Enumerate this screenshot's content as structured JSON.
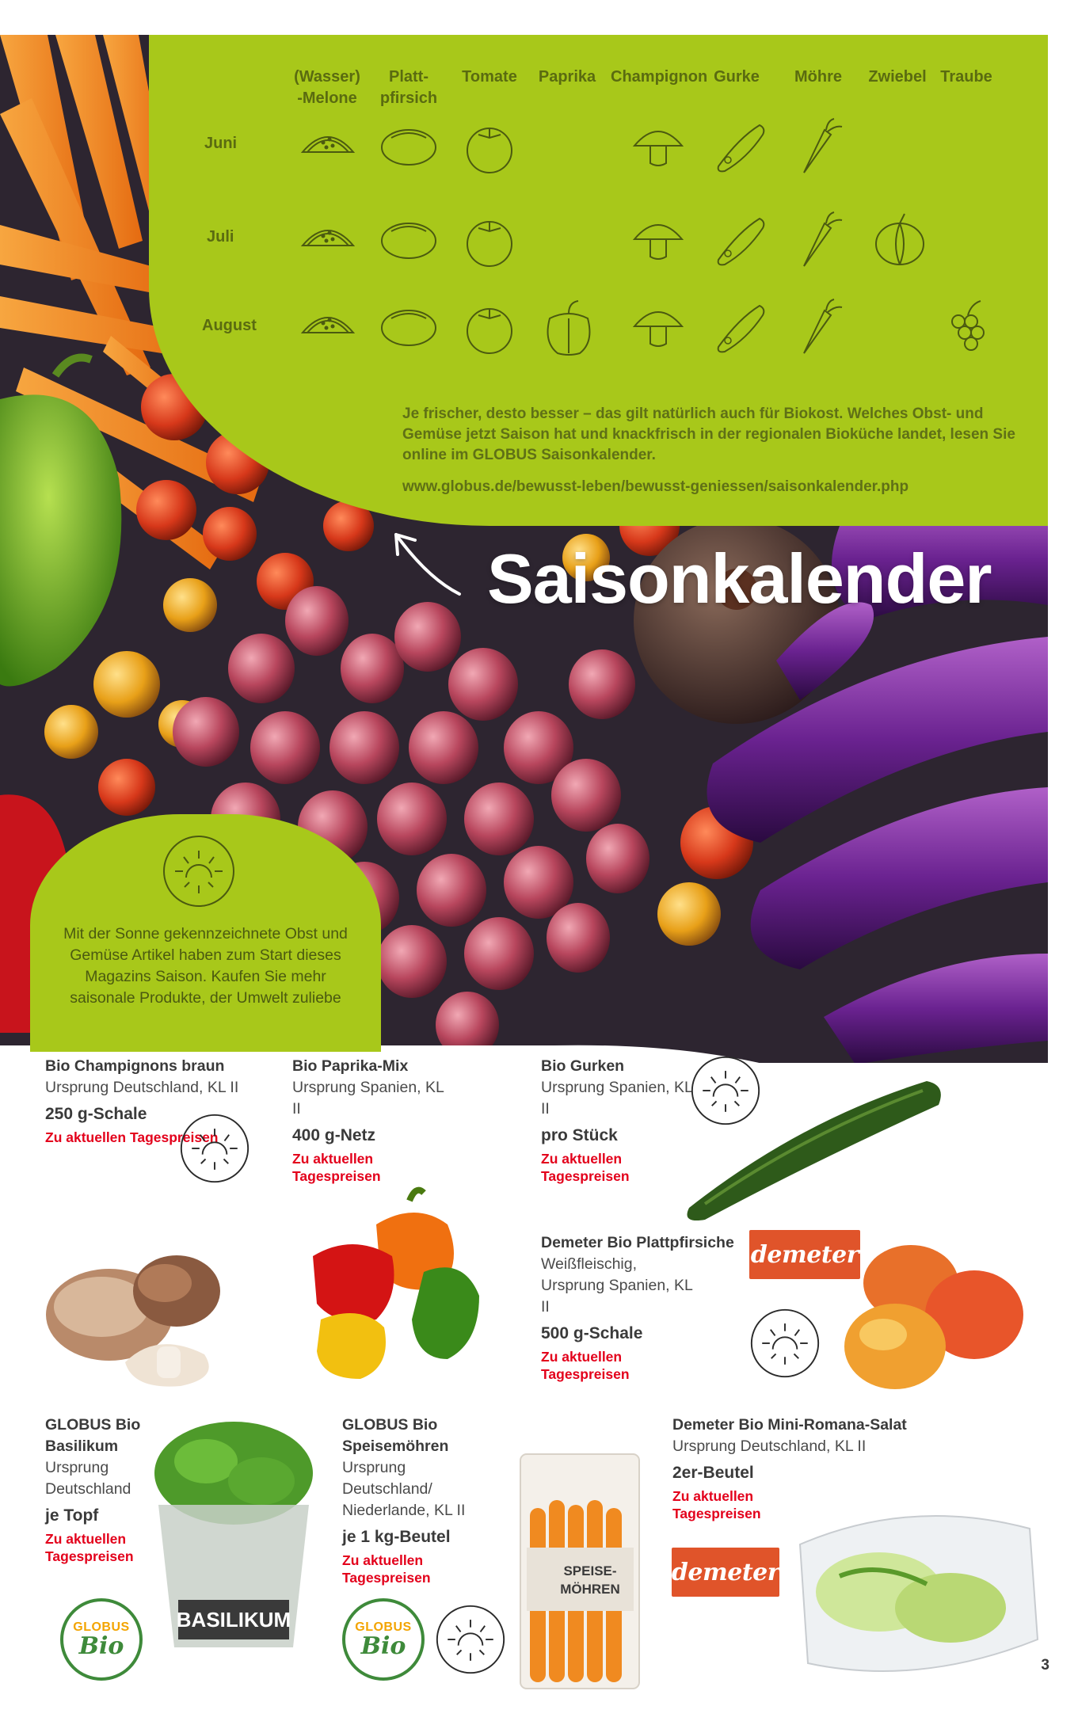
{
  "calendar": {
    "columns": [
      "(Wasser)\n-Melone",
      "Platt-\npfirsich",
      "Tomate",
      "Paprika",
      "Champignon",
      "Gurke",
      "Möhre",
      "Zwiebel",
      "Traube"
    ],
    "months": [
      "Juni",
      "Juli",
      "August"
    ],
    "text": "Je frischer, desto besser – das gilt natürlich auch für Biokost. Welches Obst- und Gemüse jetzt Saison hat und knackfrisch in der regionalen Bioküche landet, lesen Sie online im GLOBUS Saisonkalender.",
    "url": "www.globus.de/bewusst-leben/bewusst-geniessen/saisonkalender.php"
  },
  "headline": "Saisonkalender",
  "sun_note": "Mit der Sonne gekennzeichnete  Obst und Gemüse Artikel haben zum Start dieses Magazins Saison. Kaufen Sie mehr saisonale Produkte, der Umwelt zuliebe",
  "products": {
    "champignons": {
      "name": "Bio Champignons braun",
      "desc": "Ursprung Deutschland, KL II",
      "unit": "250 g-Schale",
      "price": "Zu aktuellen Tagespreisen"
    },
    "paprika": {
      "name": "Bio Paprika-Mix",
      "desc": "Ursprung Spanien, KL II",
      "unit": "400 g-Netz",
      "price": "Zu aktuellen Tagespreisen"
    },
    "gurken": {
      "name": "Bio Gurken",
      "desc": "Ursprung Spanien, KL II",
      "unit": "pro Stück",
      "price": "Zu aktuellen Tagespreisen"
    },
    "plattpfirsiche": {
      "name": "Demeter Bio Plattpfirsiche",
      "desc": "Weißfleischig, Ursprung Spanien, KL II",
      "unit": "500 g-Schale",
      "price": "Zu aktuellen Tagespreisen"
    },
    "basilikum": {
      "name": "GLOBUS Bio Basilikum",
      "desc": "Ursprung Deutschland",
      "unit": "je Topf",
      "price": "Zu aktuellen Tagespreisen"
    },
    "moehren": {
      "name": "GLOBUS Bio Speisemöhren",
      "desc": "Ursprung Deutschland/ Niederlande, KL II",
      "unit": "je 1 kg-Beutel",
      "price": "Zu aktuellen Tagespreisen"
    },
    "romana": {
      "name": "Demeter Bio Mini-Romana-Salat",
      "desc": "Ursprung Deutschland, KL II",
      "unit": "2er-Beutel",
      "price": "Zu aktuellen Tagespreisen"
    }
  },
  "logos": {
    "demeter": "demeter",
    "globus_bio_top": "GLOBUS",
    "globus_bio_bottom": "Bio",
    "pot_label": "BASILIKUM",
    "bag_label": "SPEISE-\nMÖHREN"
  },
  "page_number": "3",
  "colors": {
    "green": "#a8c81a",
    "red_price": "#e3001b",
    "demeter": "#e0542a",
    "globus_green": "#3e8a3a"
  }
}
